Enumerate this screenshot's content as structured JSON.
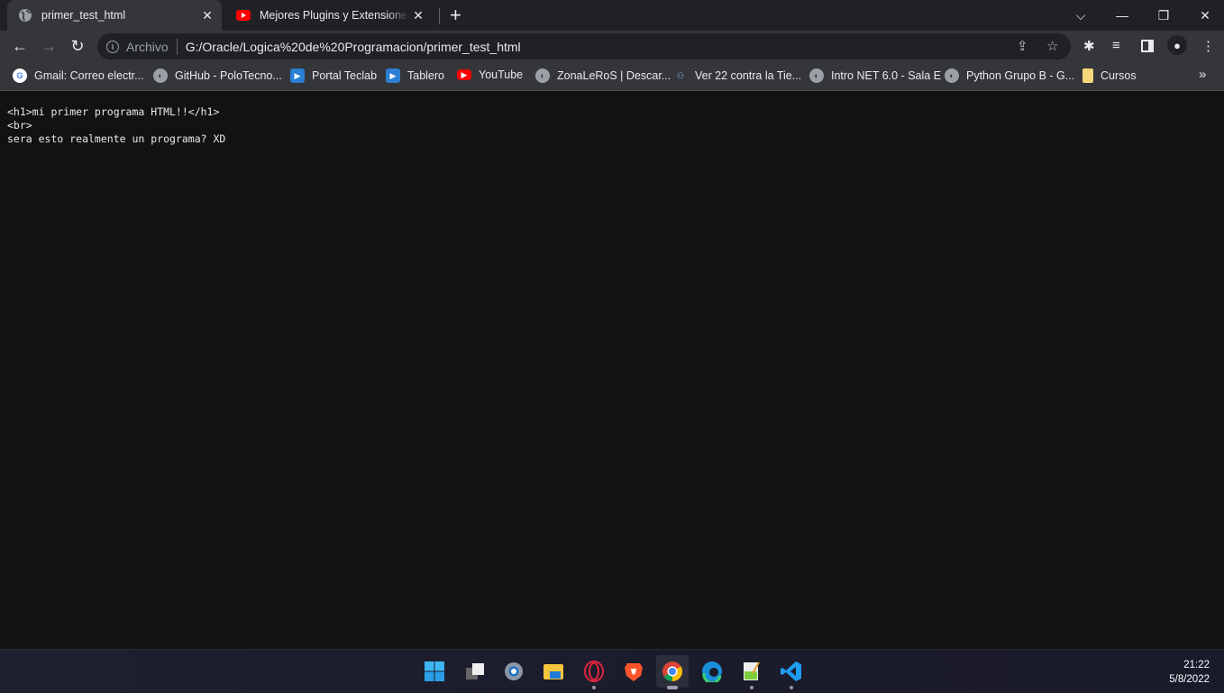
{
  "tabs": [
    {
      "title": "primer_test_html",
      "icon": "globe-icon",
      "active": true
    },
    {
      "title": "Mejores Plugins y Extensiones de",
      "icon": "youtube-icon",
      "active": false
    }
  ],
  "address": {
    "scheme_label": "Archivo",
    "url": "G:/Oracle/Logica%20de%20Programacion/primer_test_html"
  },
  "bookmarks": [
    {
      "label": "Gmail: Correo electr...",
      "icon": "google-icon"
    },
    {
      "label": "GitHub - PoloTecno...",
      "icon": "globe-icon"
    },
    {
      "label": "Portal Teclab",
      "icon": "teclab-icon"
    },
    {
      "label": "Tablero",
      "icon": "teclab-icon"
    },
    {
      "label": "YouTube",
      "icon": "youtube-icon"
    },
    {
      "label": "ZonaLeRoS | Descar...",
      "icon": "globe-icon"
    },
    {
      "label": "Ver 22 contra la Tie...",
      "icon": "people-icon"
    },
    {
      "label": "Intro NET 6.0 - Sala E",
      "icon": "globe-icon"
    },
    {
      "label": "Python Grupo B - G...",
      "icon": "globe-icon"
    },
    {
      "label": "Cursos",
      "icon": "folder-icon"
    }
  ],
  "page": {
    "lines": [
      "<h1>mi primer programa HTML!!</h1>",
      "<br>",
      "sera esto realmente un programa? XD"
    ]
  },
  "taskbar": {
    "apps": [
      {
        "name": "start",
        "icon": "windows-start-icon",
        "running": false
      },
      {
        "name": "task-view",
        "icon": "task-view-icon",
        "running": false
      },
      {
        "name": "settings",
        "icon": "gear-icon",
        "running": false
      },
      {
        "name": "file-explorer",
        "icon": "folder-icon",
        "running": false
      },
      {
        "name": "opera",
        "icon": "opera-icon",
        "running": true
      },
      {
        "name": "brave",
        "icon": "brave-icon",
        "running": false
      },
      {
        "name": "chrome",
        "icon": "chrome-icon",
        "running": true,
        "active": true
      },
      {
        "name": "edge",
        "icon": "edge-icon",
        "running": false
      },
      {
        "name": "notepad-plus",
        "icon": "notepad-icon",
        "running": true
      },
      {
        "name": "vscode",
        "icon": "vscode-icon",
        "running": true
      }
    ],
    "time": "21:22",
    "date": "5/8/2022"
  },
  "colors": {
    "frame": "#202124",
    "toolbar": "#35363a",
    "page_bg": "#121212",
    "youtube_red": "#ff0000"
  }
}
